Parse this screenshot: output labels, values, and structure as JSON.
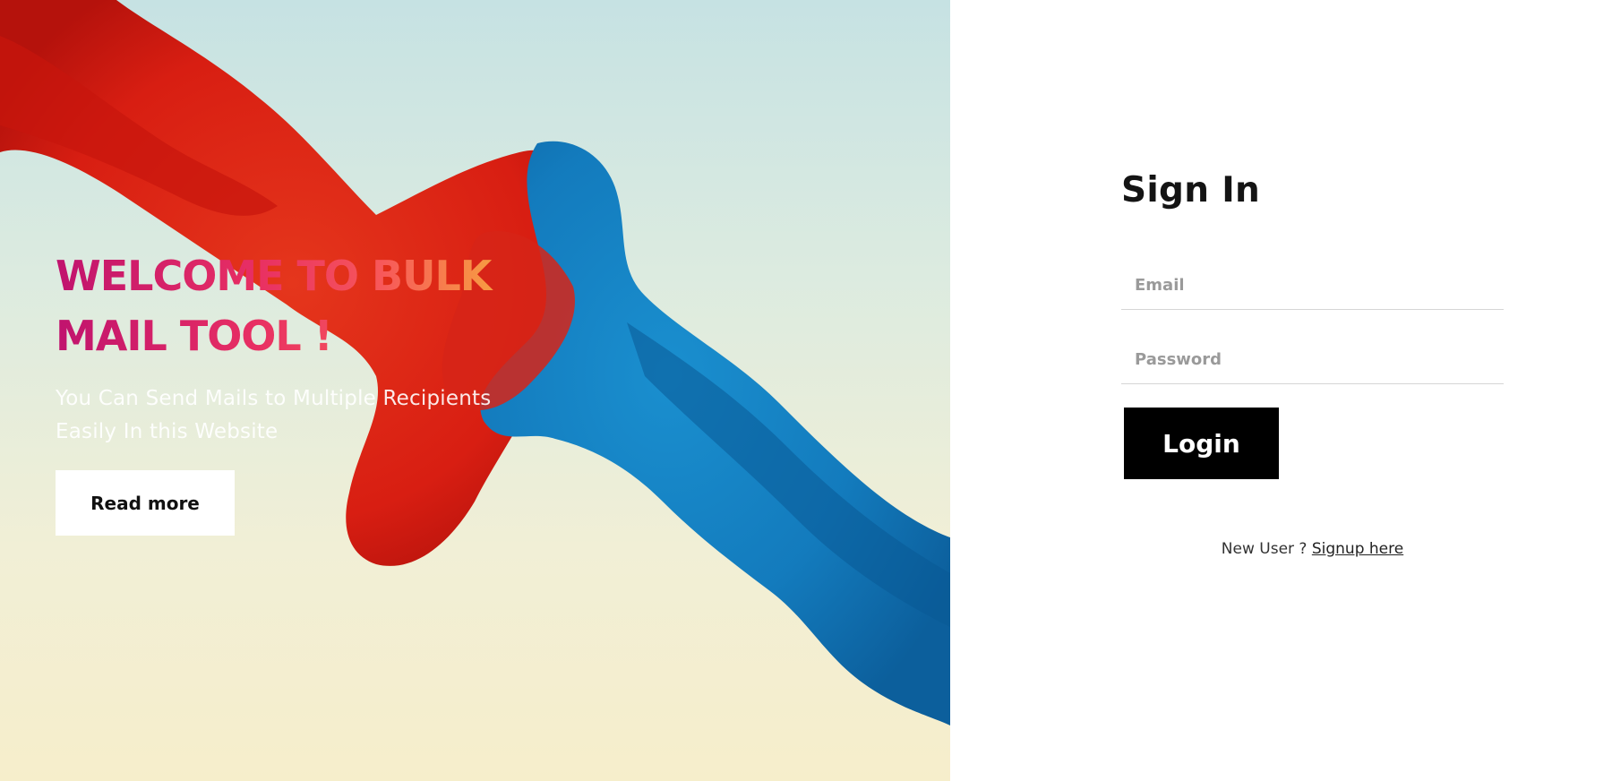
{
  "hero": {
    "title_line1": "WELCOME TO BULK",
    "title_line2": "MAIL TOOL !",
    "subtitle_line1": "You Can Send Mails to Multiple Recipients",
    "subtitle_line2": "Easily In this Website",
    "read_more_label": "Read more",
    "background_art": "red and blue ink plume illustration"
  },
  "signin": {
    "title": "Sign In",
    "email_placeholder": "Email",
    "password_placeholder": "Password",
    "login_label": "Login",
    "new_user_text": "New User ? ",
    "signup_link_label": "Signup here"
  },
  "colors": {
    "title_gradient_start": "#c0136e",
    "title_gradient_end": "#f7b33a",
    "login_button_bg": "#000000",
    "panel_bg": "#ffffff"
  }
}
